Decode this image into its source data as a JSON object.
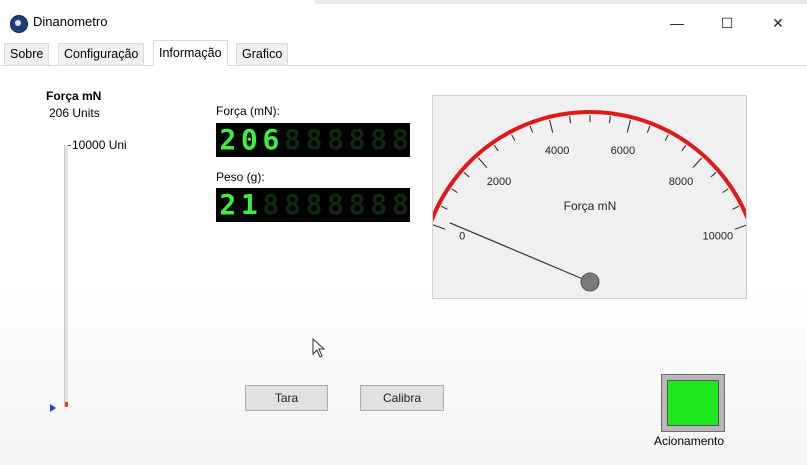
{
  "window": {
    "title": "Dinanometro",
    "controls": {
      "minimize": "—",
      "maximize": "☐",
      "close": "✕"
    }
  },
  "tabs": [
    {
      "label": "Sobre"
    },
    {
      "label": "Configuração"
    },
    {
      "label": "Informação"
    },
    {
      "label": "Grafico"
    }
  ],
  "active_tab": "Informação",
  "slider": {
    "title": "Força mN",
    "value_text": "206 Units",
    "max_label": "10000 Uni",
    "level": 0.0206
  },
  "forca_display": {
    "label": "Força (mN):",
    "chars": [
      "2",
      "0",
      "6",
      "8",
      "8",
      "8",
      "8",
      "8",
      "8"
    ],
    "lit": 3,
    "value": 206
  },
  "peso_display": {
    "label": "Peso (g):",
    "chars": [
      "2",
      "1",
      "8",
      "8",
      "8",
      "8",
      "8",
      "8",
      "8"
    ],
    "lit": 2,
    "value": 21
  },
  "gauge": {
    "label": "Força mN",
    "min": 0,
    "max": 10000,
    "value": 206,
    "tick_labels": [
      "0",
      "2000",
      "4000",
      "6000",
      "8000",
      "10000"
    ],
    "colors": {
      "arc": "#dd1a1a",
      "needle": "#333333",
      "hub": "#7a7a7a"
    }
  },
  "buttons": {
    "tara": "Tara",
    "calibra": "Calibra"
  },
  "acionamento": {
    "label": "Acionamento",
    "state": "on",
    "color": "#1fe81f"
  }
}
